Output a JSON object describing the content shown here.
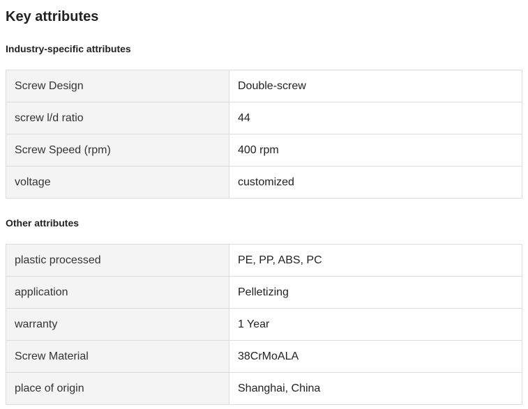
{
  "title": "Key attributes",
  "sections": [
    {
      "heading": "Industry-specific attributes",
      "rows": [
        {
          "key": "Screw Design",
          "value": "Double-screw"
        },
        {
          "key": "screw l/d ratio",
          "value": "44"
        },
        {
          "key": "Screw Speed (rpm)",
          "value": "400 rpm"
        },
        {
          "key": "voltage",
          "value": "customized"
        }
      ]
    },
    {
      "heading": "Other attributes",
      "rows": [
        {
          "key": "plastic processed",
          "value": "PE, PP, ABS, PC"
        },
        {
          "key": "application",
          "value": "Pelletizing"
        },
        {
          "key": "warranty",
          "value": "1 Year"
        },
        {
          "key": "Screw Material",
          "value": "38CrMoALA"
        },
        {
          "key": "place of origin",
          "value": "Shanghai, China"
        }
      ]
    }
  ]
}
